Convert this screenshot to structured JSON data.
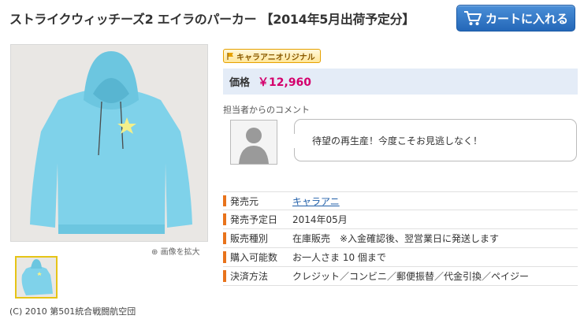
{
  "product": {
    "title": "ストライクウィッチーズ2 エイラのパーカー 【2014年5月出荷予定分】",
    "badge": "キャラアニオリジナル",
    "price_label": "価格",
    "price_value": "￥12,960"
  },
  "cart_button": {
    "label": "カートに入れる",
    "icon": "shopping-cart-icon"
  },
  "gallery": {
    "zoom_label": "画像を拡大",
    "copyright": "(C) 2010 第501統合戦闘航空団"
  },
  "comment": {
    "label": "担当者からのコメント",
    "text": "待望の再生産！今度こそお見逃しなく！"
  },
  "info": [
    {
      "key": "発売元",
      "value": "キャラアニ",
      "is_link": true
    },
    {
      "key": "発売予定日",
      "value": "2014年05月",
      "is_link": false
    },
    {
      "key": "販売種別",
      "value": "在庫販売　※入金確認後、翌営業日に発送します",
      "is_link": false
    },
    {
      "key": "購入可能数",
      "value": "お一人さま 10 個まで",
      "is_link": false
    },
    {
      "key": "決済方法",
      "value": "クレジット／コンビニ／郵便振替／代金引換／ペイジー",
      "is_link": false
    }
  ],
  "colors": {
    "price": "#d4006c",
    "cart_button": "#2f74c8",
    "row_marker": "#e8731c",
    "hoodie": "#7fd2ea",
    "star": "#f3f08a"
  }
}
